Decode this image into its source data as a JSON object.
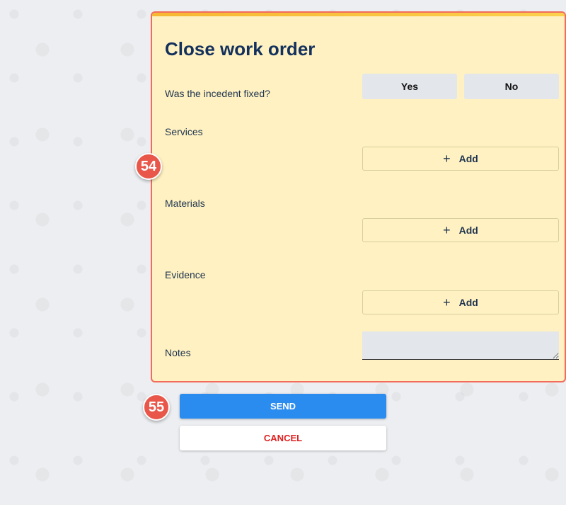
{
  "form": {
    "title": "Close work order",
    "fixed_question": "Was the incedent fixed?",
    "yes_label": "Yes",
    "no_label": "No",
    "services_label": "Services",
    "materials_label": "Materials",
    "evidence_label": "Evidence",
    "add_label": "Add",
    "plus_symbol": "+",
    "notes_label": "Notes",
    "notes_value": ""
  },
  "actions": {
    "send_label": "SEND",
    "cancel_label": "CANCEL"
  },
  "annotations": {
    "panel_badge": "54",
    "actions_badge": "55"
  },
  "colors": {
    "panel_bg": "#fff1c1",
    "panel_border": "#f26b5b",
    "send_bg": "#2b8cf0",
    "cancel_text": "#e02020",
    "badge_bg": "#e8574a"
  }
}
